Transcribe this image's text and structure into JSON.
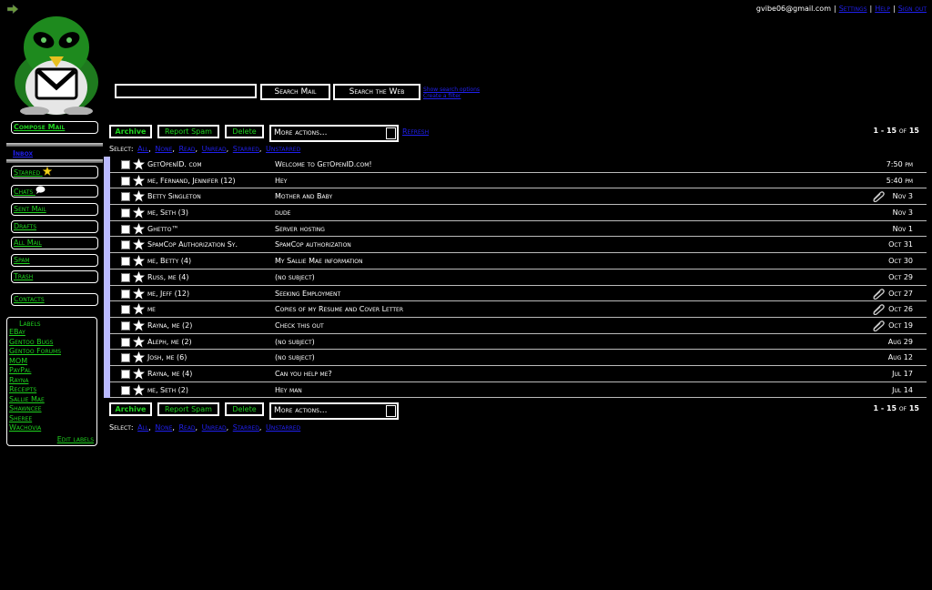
{
  "user": {
    "email": "gvibe06@gmail.com",
    "settings_label": "Settings",
    "help_label": "Help",
    "signout_label": "Sign out"
  },
  "search": {
    "query": "",
    "mail_button": "Search Mail",
    "web_button": "Search the Web",
    "options_link": "Show search options",
    "filter_link": "Create a filter"
  },
  "nav": {
    "compose": "Compose Mail",
    "inbox": "Inbox",
    "starred": "Starred",
    "chats": "Chats",
    "sent": "Sent Mail",
    "drafts": "Drafts",
    "all": "All Mail",
    "spam": "Spam",
    "trash": "Trash",
    "contacts": "Contacts"
  },
  "labels": {
    "title": "Labels",
    "items": [
      "EBay",
      "Gentoo Bugs",
      "Gentoo Forums",
      "MOM",
      "PayPal",
      "Rayna",
      "Receipts",
      "Sallie Mae",
      "Shawncee",
      "Sheree",
      "Wachovia"
    ],
    "edit": "Edit labels"
  },
  "toolbar": {
    "archive": "Archive",
    "report_spam": "Report Spam",
    "delete": "Delete",
    "more_actions": "More actions...",
    "refresh": "Refresh",
    "pager_range": "1 - 15",
    "pager_of": "of",
    "pager_total": "15"
  },
  "select": {
    "label": "Select:",
    "all": "All",
    "none": "None",
    "read": "Read",
    "unread": "Unread",
    "starred": "Starred",
    "unstarred": "Unstarred"
  },
  "messages": [
    {
      "sender": "GetOpenID. com",
      "subject": "Welcome to GetOpenID.com!",
      "date": "7:50 pm",
      "attachment": false
    },
    {
      "sender": "me, Fernand, Jennifer (12)",
      "subject": "Hey",
      "date": "5:40 pm",
      "attachment": false
    },
    {
      "sender": "Betty Singleton",
      "subject": "Mother and Baby",
      "date": "Nov 3",
      "attachment": true
    },
    {
      "sender": "me, Seth (3)",
      "subject": "dude",
      "date": "Nov 3",
      "attachment": false
    },
    {
      "sender": "Ghetto™",
      "subject": "Server hosting",
      "date": "Nov 1",
      "attachment": false
    },
    {
      "sender": "SpamCop Authorization Sy.",
      "subject": "SpamCop authorization",
      "date": "Oct 31",
      "attachment": false
    },
    {
      "sender": "me, Betty (4)",
      "subject": "My Sallie Mae information",
      "date": "Oct 30",
      "attachment": false
    },
    {
      "sender": "Russ, me (4)",
      "subject": "(no subject)",
      "date": "Oct 29",
      "attachment": false
    },
    {
      "sender": "me, Jeff (12)",
      "subject": "Seeking Employment",
      "date": "Oct 27",
      "attachment": true
    },
    {
      "sender": "me",
      "subject": "Copies of my Resume and Cover Letter",
      "date": "Oct 26",
      "attachment": true
    },
    {
      "sender": "Rayna, me (2)",
      "subject": "Check this out",
      "date": "Oct 19",
      "attachment": true
    },
    {
      "sender": "Aleph, me (2)",
      "subject": "(no subject)",
      "date": "Aug 29",
      "attachment": false
    },
    {
      "sender": "Josh, me (6)",
      "subject": "(no subject)",
      "date": "Aug 12",
      "attachment": false
    },
    {
      "sender": "Rayna, me (4)",
      "subject": "Can you help me?",
      "date": "Jul 17",
      "attachment": false
    },
    {
      "sender": "me, Seth (2)",
      "subject": "Hey man",
      "date": "Jul 14",
      "attachment": false
    }
  ],
  "colors": {
    "background": "#000000",
    "accent_green": "#1fd31f",
    "link_blue": "#2020ee",
    "list_bar": "#b9b9ff"
  },
  "icons": [
    "arrow-right-icon",
    "penguin-gmail-logo",
    "star-icon",
    "chat-bubble-icon",
    "paperclip-icon",
    "checkbox-icon"
  ]
}
